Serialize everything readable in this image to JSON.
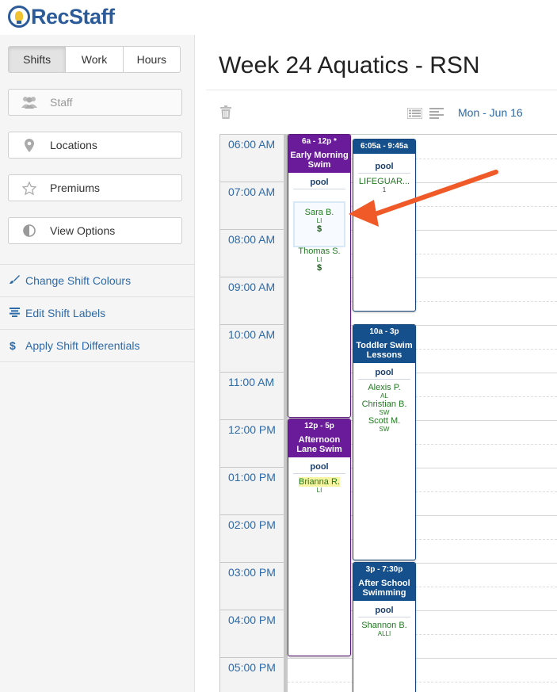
{
  "app": {
    "name": "RecStaff"
  },
  "view_tabs": [
    {
      "label": "Shifts",
      "active": true
    },
    {
      "label": "Work",
      "active": false
    },
    {
      "label": "Hours",
      "active": false
    }
  ],
  "sidebar": {
    "buttons": [
      {
        "label": "Staff",
        "icon": "users-icon",
        "disabled": true
      },
      {
        "label": "Locations",
        "icon": "map-pin-icon"
      },
      {
        "label": "Premiums",
        "icon": "star-icon"
      },
      {
        "label": "View Options",
        "icon": "contrast-icon"
      }
    ],
    "links": [
      {
        "label": "Change Shift Colours",
        "icon": "paintbrush-icon"
      },
      {
        "label": "Edit Shift Labels",
        "icon": "align-center-icon"
      },
      {
        "label": "Apply Shift Differentials",
        "icon": "dollar-icon"
      }
    ]
  },
  "page": {
    "title": "Week 24 Aquatics - RSN",
    "date": "Mon - Jun 16"
  },
  "times": [
    "06:00 AM",
    "07:00 AM",
    "08:00 AM",
    "09:00 AM",
    "10:00 AM",
    "11:00 AM",
    "12:00 PM",
    "01:00 PM",
    "02:00 PM",
    "03:00 PM",
    "04:00 PM",
    "05:00 PM"
  ],
  "shifts": [
    {
      "time": "6a - 12p  *",
      "title": "Early Morning Swim",
      "location": "pool",
      "color": "#6a1b9a",
      "staff": [
        {
          "name": "Sara B.",
          "pos": "LI",
          "pay": "$"
        },
        {
          "name": "Thomas S.",
          "pos": "LI",
          "pay": "$"
        }
      ]
    },
    {
      "time": "12p - 5p",
      "title": "Afternoon Lane Swim",
      "location": "pool",
      "color": "#6a1b9a",
      "staff": [
        {
          "name": "Brianna R.",
          "pos": "LI"
        }
      ]
    },
    {
      "time": "6:05a - 9:45a",
      "location": "pool",
      "color": "#16508c",
      "staff": [
        {
          "name": "LIFEGUAR...",
          "pos": "1"
        }
      ]
    },
    {
      "time": "10a - 3p",
      "title": "Toddler Swim Lessons",
      "location": "pool",
      "color": "#16508c",
      "staff": [
        {
          "name": "Alexis P.",
          "pos": "AL"
        },
        {
          "name": "Christian B.",
          "pos": "SW"
        },
        {
          "name": "Scott M.",
          "pos": "SW"
        }
      ]
    },
    {
      "time": "3p - 7:30p",
      "title": "After School Swimming",
      "location": "pool",
      "color": "#16508c",
      "staff": [
        {
          "name": "Shannon B.",
          "pos": "ALLI"
        }
      ]
    }
  ],
  "annotation": {
    "arrow_color": "#ef5a28"
  }
}
